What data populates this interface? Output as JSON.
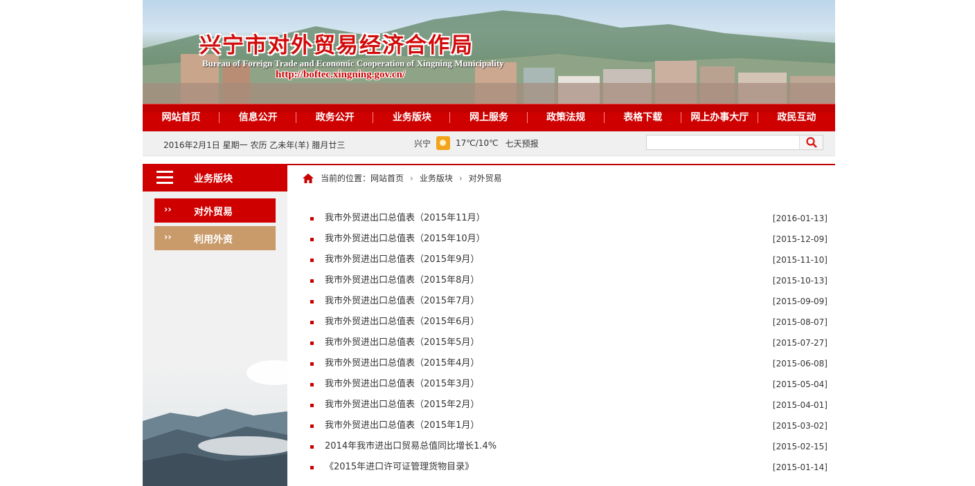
{
  "header": {
    "title_cn": "兴宁市对外贸易经济合作局",
    "title_en": "Bureau of Foreign Trade and Economic Cooperation of Xingning Municipality",
    "url": "http://boftec.xingning.gov.cn/"
  },
  "nav": {
    "items": [
      "网站首页",
      "信息公开",
      "政务公开",
      "业务版块",
      "网上服务",
      "政策法规",
      "表格下载",
      "网上办事大厅",
      "政民互动"
    ]
  },
  "info_bar": {
    "date": "2016年2月1日 星期一 农历 乙未年(羊) 腊月廿三",
    "city": "兴宁",
    "temperature": "17℃/10℃",
    "forecast_link": "七天预报",
    "weather_icon": "sunny-icon",
    "search_placeholder": ""
  },
  "sidebar": {
    "title": "业务版块",
    "items": [
      {
        "label": "对外贸易",
        "active": true
      },
      {
        "label": "利用外资",
        "active": false
      }
    ]
  },
  "breadcrumb": {
    "prefix": "当前的位置：",
    "items": [
      "网站首页",
      "业务版块",
      "对外贸易"
    ]
  },
  "articles": [
    {
      "title": "我市外贸进出口总值表（2015年11月）",
      "date": "[2016-01-13]"
    },
    {
      "title": "我市外贸进出口总值表（2015年10月）",
      "date": "[2015-12-09]"
    },
    {
      "title": "我市外贸进出口总值表（2015年9月）",
      "date": "[2015-11-10]"
    },
    {
      "title": "我市外贸进出口总值表（2015年8月）",
      "date": "[2015-10-13]"
    },
    {
      "title": "我市外贸进出口总值表（2015年7月）",
      "date": "[2015-09-09]"
    },
    {
      "title": "我市外贸进出口总值表（2015年6月）",
      "date": "[2015-08-07]"
    },
    {
      "title": "我市外贸进出口总值表（2015年5月）",
      "date": "[2015-07-27]"
    },
    {
      "title": "我市外贸进出口总值表（2015年4月）",
      "date": "[2015-06-08]"
    },
    {
      "title": "我市外贸进出口总值表（2015年3月）",
      "date": "[2015-05-04]"
    },
    {
      "title": "我市外贸进出口总值表（2015年2月）",
      "date": "[2015-04-01]"
    },
    {
      "title": "我市外贸进出口总值表（2015年1月）",
      "date": "[2015-03-02]"
    },
    {
      "title": "2014年我市进出口贸易总值同比增长1.4%",
      "date": "[2015-02-15]"
    },
    {
      "title": "《2015年进口许可证管理货物目录》",
      "date": "[2015-01-14]"
    }
  ],
  "colors": {
    "primary_red": "#cf0000",
    "sidebar_tan": "#c99a6a"
  }
}
